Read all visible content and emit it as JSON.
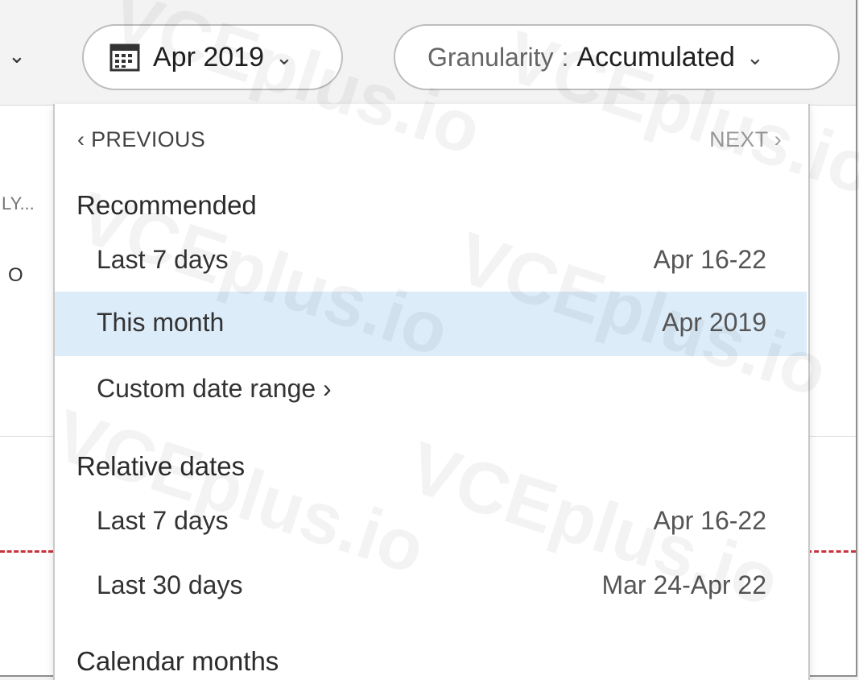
{
  "toolbar": {
    "date_picker": {
      "label": "Apr 2019",
      "icon": "calendar-icon"
    },
    "granularity": {
      "label": "Granularity",
      "separator": ":",
      "value": "Accumulated"
    }
  },
  "background": {
    "side_text_1": "LY...",
    "side_text_2": "O"
  },
  "dropdown": {
    "previous_label": "‹ PREVIOUS",
    "next_label": "NEXT ›",
    "sections": {
      "recommended": {
        "heading": "Recommended",
        "items": [
          {
            "label": "Last 7 days",
            "value": "Apr 16-22"
          },
          {
            "label": "This month",
            "value": "Apr 2019",
            "selected": true
          },
          {
            "label": "Custom date range ›",
            "value": ""
          }
        ]
      },
      "relative": {
        "heading": "Relative dates",
        "items": [
          {
            "label": "Last 7 days",
            "value": "Apr 16-22"
          },
          {
            "label": "Last 30 days",
            "value": "Mar 24-Apr 22"
          }
        ]
      },
      "calendar": {
        "heading": "Calendar months"
      }
    }
  },
  "watermark_text": "VCEplus.io",
  "colors": {
    "selected_row": "#dcecf9",
    "dash_line": "#c8323c",
    "pill_border": "#bdbdbd"
  }
}
